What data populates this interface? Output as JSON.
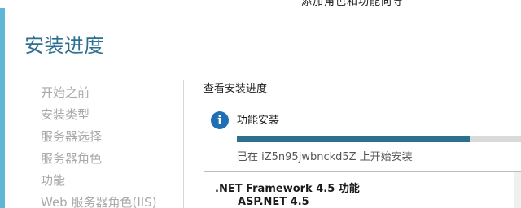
{
  "window": {
    "title": "添加角色和功能向导"
  },
  "page": {
    "title": "安装进度"
  },
  "nav": {
    "items": [
      {
        "label": "开始之前"
      },
      {
        "label": "安装类型"
      },
      {
        "label": "服务器选择"
      },
      {
        "label": "服务器角色"
      },
      {
        "label": "功能"
      },
      {
        "label": "Web 服务器角色(IIS)"
      }
    ]
  },
  "main": {
    "heading": "查看安装进度",
    "status": {
      "icon": "info-icon",
      "title": "功能安装",
      "progress": 0.82,
      "message": "已在 iZ5n95jwbnckd5Z 上开始安装"
    },
    "features": [
      {
        "label": ".NET Framework 4.5 功能",
        "level": 0
      },
      {
        "label": "ASP.NET 4.5",
        "level": 1
      }
    ]
  },
  "colors": {
    "accent": "#2f6f90",
    "progress_fill": "#2e6f8e",
    "info_icon": "#1f6fb5",
    "nav_inactive": "#a9a9a9"
  }
}
